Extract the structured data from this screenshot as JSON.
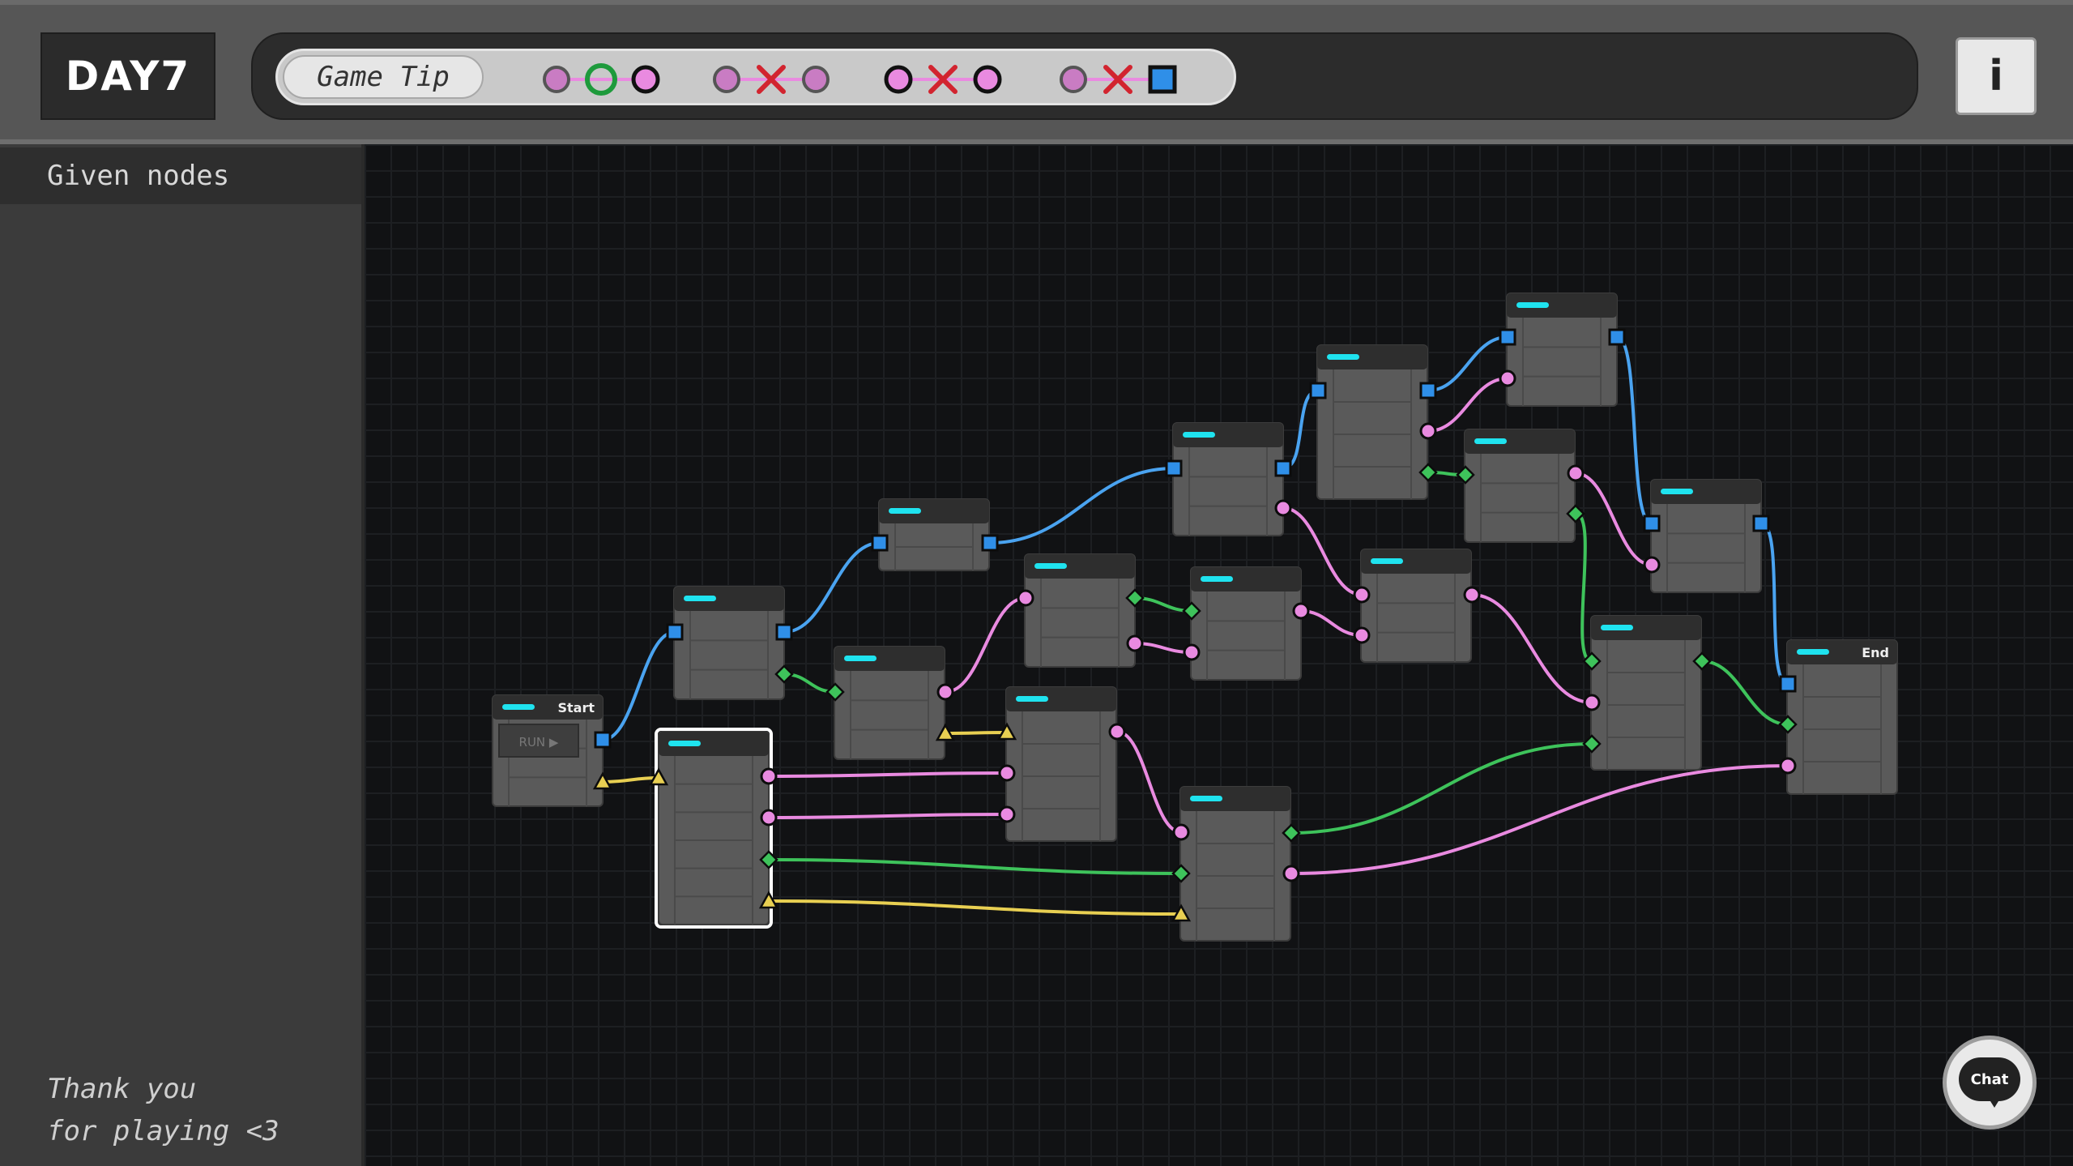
{
  "header": {
    "day_label": "DAY7",
    "tip_label": "Game Tip",
    "info_label": "i",
    "legend": [
      {
        "left": "circle-pink",
        "mid": "ring-green",
        "right": "circle-pink-dark"
      },
      {
        "left": "circle-pink",
        "mid": "cross-red",
        "right": "circle-pink"
      },
      {
        "left": "circle-pink-dark",
        "mid": "cross-red",
        "right": "circle-pink-dark"
      },
      {
        "left": "circle-pink",
        "mid": "cross-red",
        "right": "square-blue"
      }
    ]
  },
  "sidebar": {
    "title": "Given nodes",
    "thanks_line1": "Thank you",
    "thanks_line2": "for playing <3"
  },
  "graph": {
    "start_label": "Start",
    "run_label": "RUN ▶",
    "end_label": "End"
  },
  "chat": {
    "label": "Chat"
  },
  "colors": {
    "blue": "#4aa3f0",
    "pink": "#e98ae0",
    "green": "#3ec35b",
    "yellow": "#e8cf52",
    "cyan": "#1fe3ef",
    "cross": "#d2242f",
    "ring": "#1e9a3c"
  }
}
